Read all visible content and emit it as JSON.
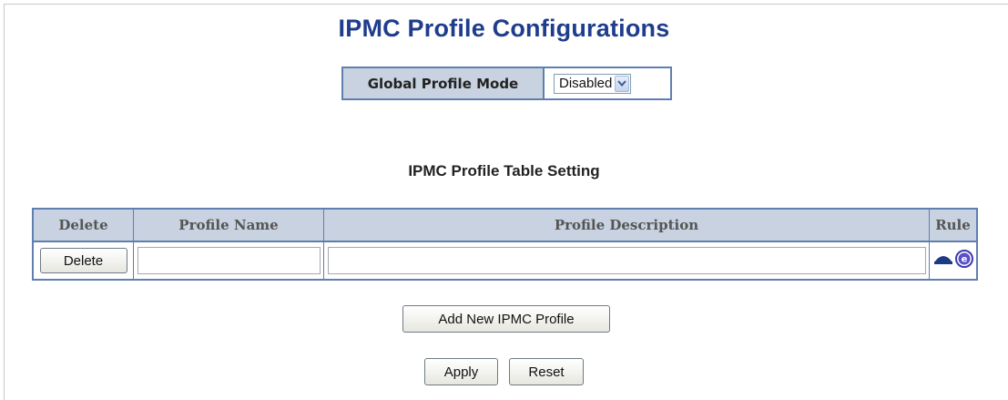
{
  "page": {
    "title": "IPMC Profile Configurations"
  },
  "global_mode": {
    "label": "Global Profile Mode",
    "selected": "Disabled",
    "options": [
      "Disabled"
    ]
  },
  "table": {
    "title": "IPMC Profile Table Setting",
    "columns": [
      "Delete",
      "Profile Name",
      "Profile Description",
      "Rule"
    ],
    "rows": [
      {
        "delete_label": "Delete",
        "profile_name": "",
        "profile_description": "",
        "rule_icons": [
          "navigate-icon",
          "edit-icon"
        ]
      }
    ]
  },
  "actions": {
    "add_label": "Add New IPMC Profile",
    "apply_label": "Apply",
    "reset_label": "Reset"
  },
  "colors": {
    "title": "#1f3d8c",
    "header_bg": "#c8d2e0",
    "border": "#5f7fb0",
    "edit_icon": "#3b3bb0"
  }
}
